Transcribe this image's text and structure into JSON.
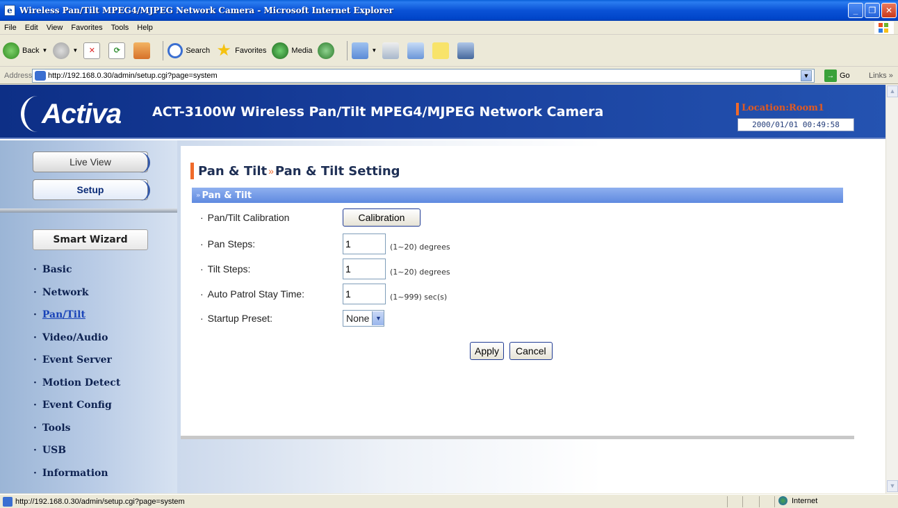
{
  "window": {
    "title": "Wireless Pan/Tilt MPEG4/MJPEG Network Camera - Microsoft Internet Explorer"
  },
  "menubar": [
    "File",
    "Edit",
    "View",
    "Favorites",
    "Tools",
    "Help"
  ],
  "toolbar": {
    "back": "Back",
    "search": "Search",
    "favorites": "Favorites",
    "media": "Media"
  },
  "address": {
    "label": "Address",
    "url": "http://192.168.0.30/admin/setup.cgi?page=system",
    "go": "Go",
    "links": "Links"
  },
  "banner": {
    "logo": "Activa",
    "title": "ACT-3100W Wireless Pan/Tilt MPEG4/MJPEG Network Camera",
    "location": "Location:Room1",
    "datetime": "2000/01/01 00:49:58"
  },
  "sidebar": {
    "live_view": "Live View",
    "setup": "Setup",
    "smart_wizard": "Smart Wizard",
    "items": [
      {
        "label": "Basic"
      },
      {
        "label": "Network"
      },
      {
        "label": "Pan/Tilt"
      },
      {
        "label": "Video/Audio"
      },
      {
        "label": "Event Server"
      },
      {
        "label": "Motion Detect"
      },
      {
        "label": "Event Config"
      },
      {
        "label": "Tools"
      },
      {
        "label": "USB"
      },
      {
        "label": "Information"
      }
    ]
  },
  "main": {
    "heading_section": "Pan & Tilt",
    "heading_page": "Pan & Tilt Setting",
    "section_title": "Pan & Tilt",
    "calibration_label": "Pan/Tilt Calibration",
    "calibration_button": "Calibration",
    "pan_steps_label": "Pan Steps:",
    "pan_steps_value": "1",
    "pan_steps_unit": "(1~20) degrees",
    "tilt_steps_label": "Tilt Steps:",
    "tilt_steps_value": "1",
    "tilt_steps_unit": "(1~20) degrees",
    "patrol_label": "Auto Patrol Stay Time:",
    "patrol_value": "1",
    "patrol_unit": "(1~999) sec(s)",
    "startup_label": "Startup Preset:",
    "startup_value": "None",
    "apply": "Apply",
    "cancel": "Cancel"
  },
  "status": {
    "text": "http://192.168.0.30/admin/setup.cgi?page=system",
    "zone": "Internet"
  }
}
